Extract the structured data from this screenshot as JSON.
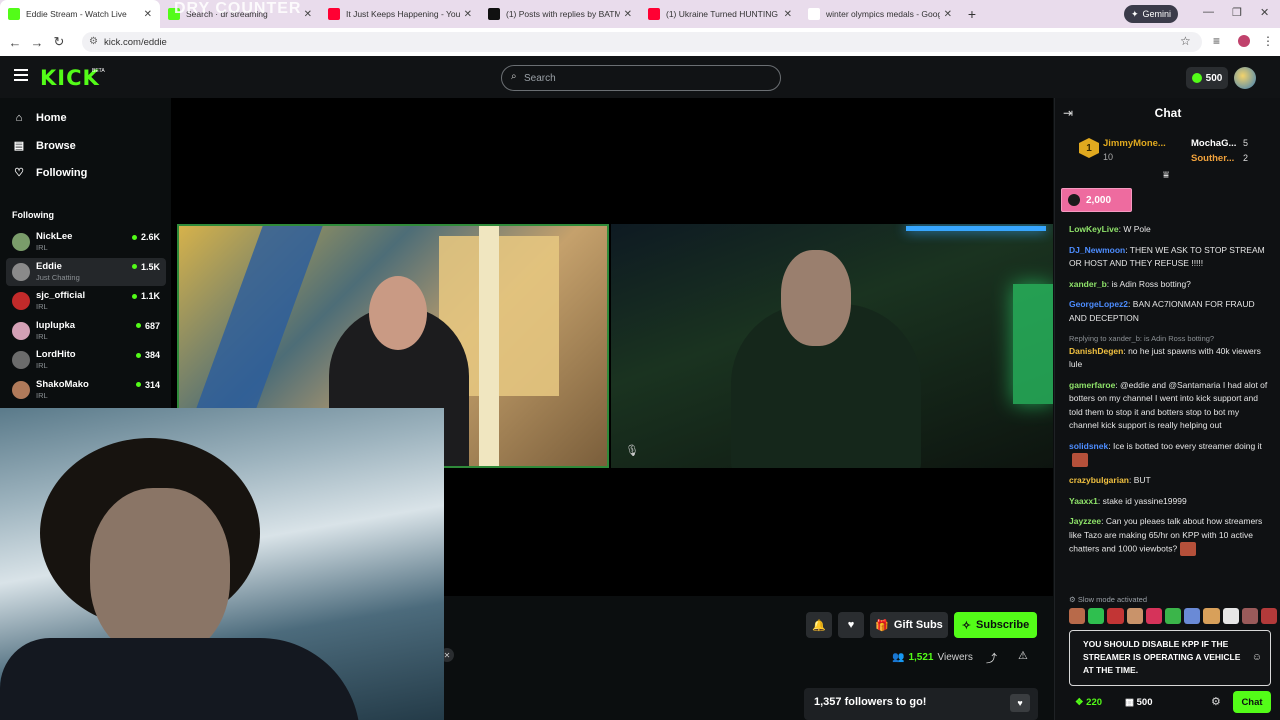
{
  "browser": {
    "tabs": [
      {
        "title": "Eddie Stream - Watch Live",
        "favicon_color": "#53fc18",
        "active": true
      },
      {
        "title": "Search · dr streaming",
        "favicon_color": "#53fc18",
        "active": false
      },
      {
        "title": "It Just Keeps Happening - YouT",
        "favicon_color": "#ff0033",
        "active": false
      },
      {
        "title": "(1) Posts with replies by BATMA",
        "favicon_color": "#111111",
        "active": false
      },
      {
        "title": "(1) Ukraine Turned HUNTING R",
        "favicon_color": "#ff0033",
        "active": false
      },
      {
        "title": "winter olympics medals - Goog",
        "favicon_color": "#ffffff",
        "active": false
      }
    ],
    "gemini_label": "Gemini",
    "url": "kick.com/eddie",
    "overlay_text": "DRY COUNTER"
  },
  "header": {
    "logo": "KICK",
    "beta": "BETA",
    "search_placeholder": "Search",
    "kicks_balance": "500"
  },
  "sidebar": {
    "nav": [
      {
        "label": "Home",
        "icon": "home-icon"
      },
      {
        "label": "Browse",
        "icon": "browse-icon"
      },
      {
        "label": "Following",
        "icon": "heart-icon"
      }
    ],
    "following_header": "Following",
    "following": [
      {
        "name": "NickLee",
        "category": "IRL",
        "viewers": "2.6K",
        "avatar": "#7a9c6a"
      },
      {
        "name": "Eddie",
        "category": "Just Chatting",
        "viewers": "1.5K",
        "avatar": "#8a8a8a"
      },
      {
        "name": "sjc_official",
        "category": "IRL",
        "viewers": "1.1K",
        "avatar": "#c22a2a"
      },
      {
        "name": "luplupka",
        "category": "IRL",
        "viewers": "687",
        "avatar": "#d3a0b5"
      },
      {
        "name": "LordHito",
        "category": "IRL",
        "viewers": "384",
        "avatar": "#6b6b6b"
      },
      {
        "name": "ShakoMako",
        "category": "IRL",
        "viewers": "314",
        "avatar": "#b07a5a"
      }
    ]
  },
  "stream": {
    "gift_subs_label": "Gift Subs",
    "subscribe_label": "Subscribe",
    "viewers_count": "1,521",
    "viewers_label": "Viewers",
    "goal_text": "1,357 followers to go!"
  },
  "chat": {
    "title": "Chat",
    "leaderboard": [
      {
        "rank": "1",
        "name": "JimmyMone...",
        "value": "10",
        "color": "#e0a91f"
      },
      {
        "rank": "2",
        "name": "MochaG...",
        "value": "5",
        "color": "#ffffff"
      },
      {
        "rank": "3",
        "name": "Souther...",
        "value": "2",
        "color": "#f0a23c"
      }
    ],
    "kicks_goal": "2,000",
    "messages": [
      {
        "user": "LowKeyLive",
        "color": "#8fe36a",
        "text": "W Pole"
      },
      {
        "user": "DJ_Newmoon",
        "color": "#4d8dff",
        "text": "THEN WE ASK TO STOP STREAM OR HOST AND THEY REFUSE !!!!!"
      },
      {
        "user": "xander_b",
        "color": "#8fe36a",
        "text": "is Adin Ross botting?"
      },
      {
        "user": "GeorgeLopez2",
        "color": "#4d8dff",
        "text": "BAN AC7IONMAN FOR FRAUD AND DECEPTION"
      },
      {
        "reply": "Replying to xander_b: is Adin Ross botting?",
        "user": "DanishDegen",
        "color": "#f0c040",
        "text": "no he just spawns with 40k viewers lule"
      },
      {
        "user": "gamerfaroe",
        "color": "#8fe36a",
        "text": "@eddie and @Santamaria I had alot of botters on my channel I went into kick support and told them to stop it and botters stop to bot my channel kick support is really helping out"
      },
      {
        "user": "solidsnek",
        "color": "#4d8dff",
        "text": "Ice is botted too every streamer doing it"
      },
      {
        "user": "crazybulgarian",
        "color": "#f0c040",
        "text": "BUT"
      },
      {
        "user": "Yaaxx1",
        "color": "#8fe36a",
        "text": "stake id yassine19999"
      },
      {
        "user": "Jayzzee",
        "color": "#8fe36a",
        "text": "Can you pleaes talk about how streamers like Tazo are making 65/hr on KPP with 10 active chatters and 1000 viewbots?"
      }
    ],
    "slow_mode": "Slow mode activated",
    "input_text": "YOU SHOULD DISABLE KPP IF THE STREAMER IS OPERATING A VEHICLE AT THE TIME.",
    "points": "220",
    "store": "500",
    "chat_button": "Chat"
  }
}
